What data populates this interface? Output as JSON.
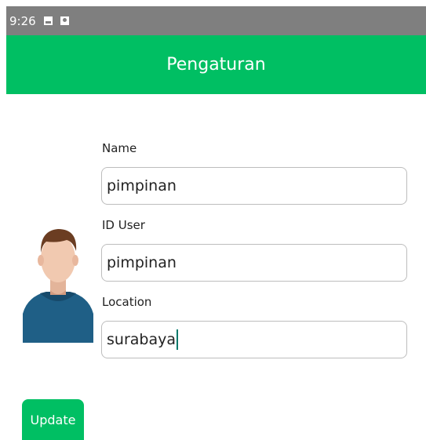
{
  "status_bar": {
    "time": "9:26",
    "icons": [
      "image-icon",
      "contact-icon"
    ]
  },
  "app_bar": {
    "title": "Pengaturan"
  },
  "form": {
    "name_label": "Name",
    "name_value": "pimpinan",
    "id_label": "ID User",
    "id_value": "pimpinan",
    "location_label": "Location",
    "location_value": "surabaya"
  },
  "actions": {
    "update_label": "Update"
  },
  "colors": {
    "primary": "#00bf63",
    "status_bar": "#7f7f7f",
    "input_border": "#bdbdbd",
    "caret": "#00796b"
  }
}
